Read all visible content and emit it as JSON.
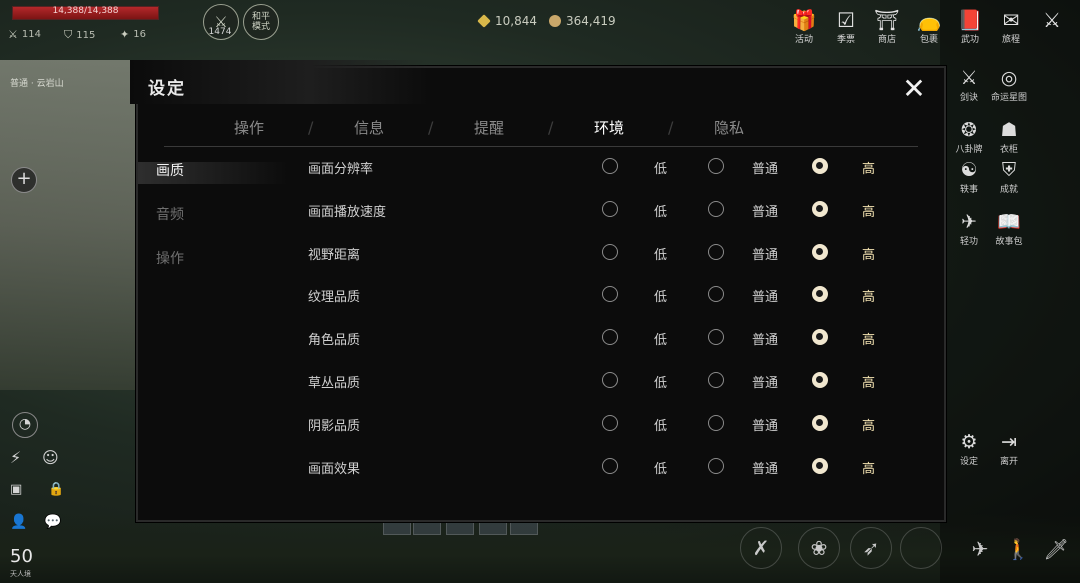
{
  "hud": {
    "hp_text": "14,388/14,388",
    "hp_fraction": 1.0,
    "stats": [
      {
        "icon": "swords-icon",
        "glyph": "⚔",
        "value": "114"
      },
      {
        "icon": "shield-icon",
        "glyph": "⛉",
        "value": "115"
      },
      {
        "icon": "sparkle-icon",
        "glyph": "✦",
        "value": "16"
      }
    ],
    "power_value": "1474",
    "mode_label": "和平\n模式",
    "currency": [
      {
        "icon": "gem-icon",
        "value": "10,844",
        "color": "#d9b84a"
      },
      {
        "icon": "coin-icon",
        "value": "364,419",
        "color": "#c9a76a"
      }
    ],
    "top_icons": [
      {
        "name": "event",
        "glyph": "🎁",
        "label": "活动"
      },
      {
        "name": "season-ticket",
        "glyph": "☑",
        "label": "季票"
      },
      {
        "name": "shop",
        "glyph": "⛩",
        "label": "商店"
      },
      {
        "name": "bag",
        "glyph": "👝",
        "label": "包裹"
      },
      {
        "name": "martial-arts",
        "glyph": "📕",
        "label": "武功"
      },
      {
        "name": "journey",
        "glyph": "✉",
        "label": "旅程"
      },
      {
        "name": "combat",
        "glyph": "⚔",
        "label": ""
      }
    ],
    "side_icons": [
      {
        "name": "sword-art",
        "glyph": "⚔",
        "label": "剑诀"
      },
      {
        "name": "fate-chart",
        "glyph": "◎",
        "label": "命运星图"
      },
      {
        "name": "eight-trigrams",
        "glyph": "❂",
        "label": "八卦牌"
      },
      {
        "name": "appearance",
        "glyph": "☗",
        "label": "衣柜"
      },
      {
        "name": "anecdote",
        "glyph": "☯",
        "label": "轶事"
      },
      {
        "name": "achievement",
        "glyph": "⛨",
        "label": "成就"
      },
      {
        "name": "qinggong",
        "glyph": "✈",
        "label": "轻功"
      },
      {
        "name": "story-pack",
        "glyph": "📖",
        "label": "故事包"
      },
      {
        "name": "settings",
        "glyph": "⚙",
        "label": "设定"
      },
      {
        "name": "leave",
        "glyph": "⇥",
        "label": "离开"
      }
    ],
    "map_location": "普通 · 云岩山",
    "level": "50",
    "level_sub": "天人境"
  },
  "dialog": {
    "title": "设定",
    "tabs": [
      {
        "label": "操作",
        "active": false
      },
      {
        "label": "信息",
        "active": false
      },
      {
        "label": "提醒",
        "active": false
      },
      {
        "label": "环境",
        "active": true
      },
      {
        "label": "隐私",
        "active": false
      }
    ],
    "side_nav": [
      {
        "label": "画质",
        "active": true
      },
      {
        "label": "音频",
        "active": false
      },
      {
        "label": "操作",
        "active": false
      }
    ],
    "option_labels": [
      "低",
      "普通",
      "高"
    ],
    "settings": [
      {
        "label": "画面分辨率",
        "selected": 2
      },
      {
        "label": "画面播放速度",
        "selected": 2
      },
      {
        "label": "视野距离",
        "selected": 2
      },
      {
        "label": "纹理品质",
        "selected": 2
      },
      {
        "label": "角色品质",
        "selected": 2
      },
      {
        "label": "草丛品质",
        "selected": 2
      },
      {
        "label": "阴影品质",
        "selected": 2
      },
      {
        "label": "画面效果",
        "selected": 2
      }
    ]
  }
}
